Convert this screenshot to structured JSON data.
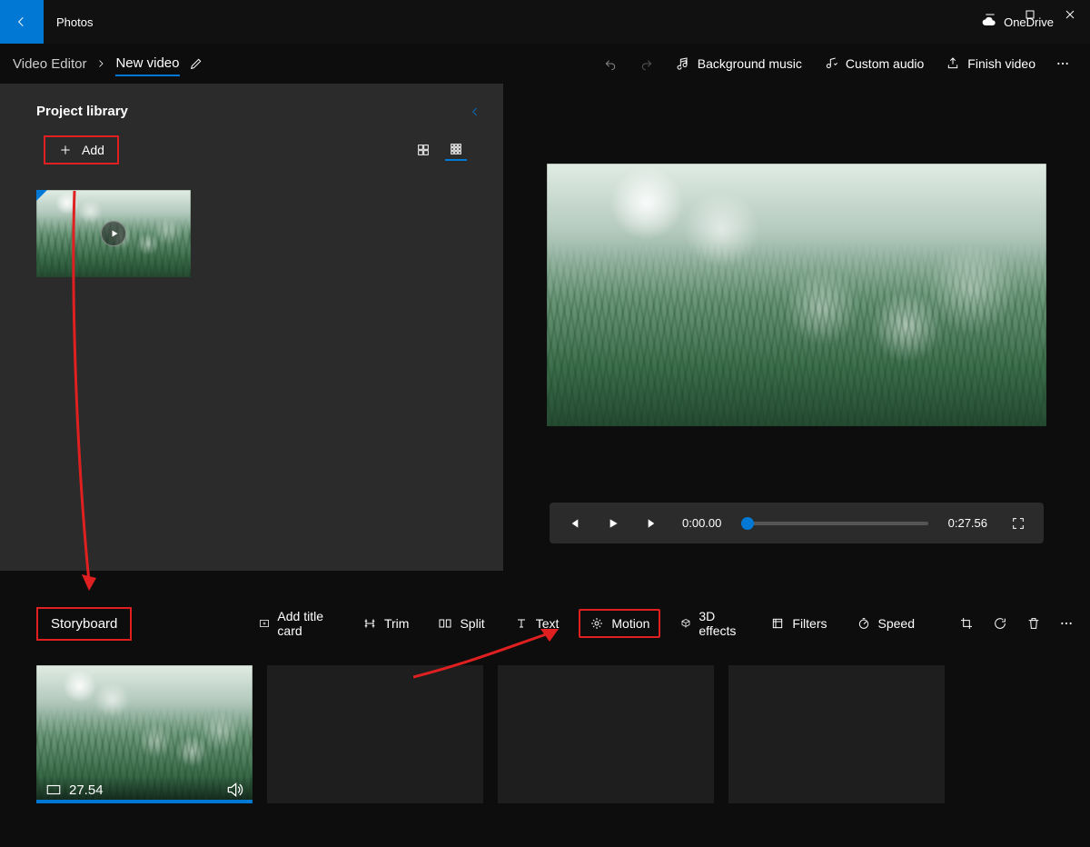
{
  "app": {
    "title": "Photos"
  },
  "cloud": {
    "label": "OneDrive"
  },
  "breadcrumb": {
    "parent": "Video Editor",
    "current": "New video"
  },
  "top_toolbar": {
    "background_music": "Background music",
    "custom_audio": "Custom audio",
    "finish_video": "Finish video"
  },
  "library": {
    "title": "Project library",
    "add_label": "Add"
  },
  "playback": {
    "current_time": "0:00.00",
    "duration": "0:27.56"
  },
  "storyboard": {
    "title": "Storyboard",
    "buttons": {
      "add_title_card": "Add title card",
      "trim": "Trim",
      "split": "Split",
      "text": "Text",
      "motion": "Motion",
      "three_d_effects": "3D effects",
      "filters": "Filters",
      "speed": "Speed"
    },
    "clip_duration": "27.54"
  }
}
